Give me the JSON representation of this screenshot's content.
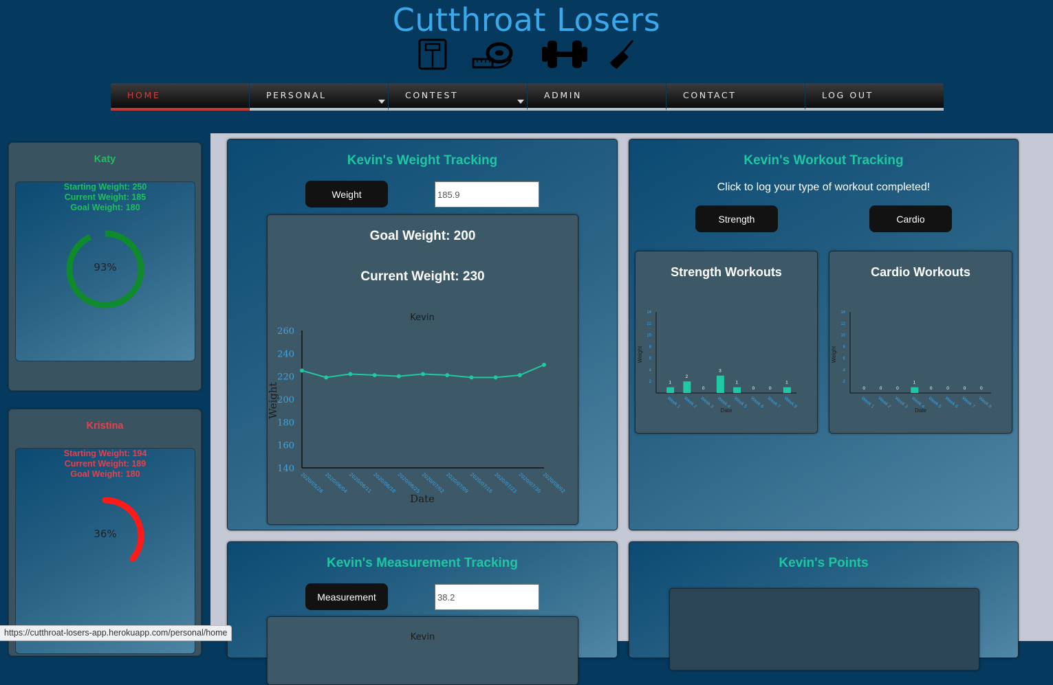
{
  "header": {
    "brand": "Cutthroat Losers",
    "icons": [
      "scale-icon",
      "tape-measure-icon",
      "dumbbell-icon",
      "knife-icon"
    ]
  },
  "nav": {
    "items": [
      {
        "label": "HOME",
        "active": true
      },
      {
        "label": "PERSONAL",
        "dropdown": true
      },
      {
        "label": "CONTEST",
        "dropdown": true
      },
      {
        "label": "ADMIN"
      },
      {
        "label": "CONTACT"
      },
      {
        "label": "LOG OUT"
      }
    ]
  },
  "sidebar": {
    "users": [
      {
        "name": "Katy",
        "starting": "Starting Weight: 250",
        "current": "Current Weight: 185",
        "goal": "Goal Weight: 180",
        "percent_label": "93%",
        "progress": 0.93,
        "color": "#0f8a2c",
        "text_color": "#1fbf5b"
      },
      {
        "name": "Kristina",
        "starting": "Starting Weight: 194",
        "current": "Current Weight: 189",
        "goal": "Goal Weight: 180",
        "percent_label": "36%",
        "progress": 0.36,
        "color": "#ff1a1a",
        "text_color": "#e6414d"
      }
    ]
  },
  "weight_panel": {
    "title": "Kevin's Weight Tracking",
    "button_label": "Weight",
    "input_value": "185.9",
    "goal_text": "Goal Weight: 200",
    "current_text": "Current Weight: 230"
  },
  "workout_panel": {
    "title": "Kevin's Workout Tracking",
    "subtitle": "Click to log your type of workout completed!",
    "strength_label": "Strength",
    "cardio_label": "Cardio",
    "strength_title": "Strength Workouts",
    "cardio_title": "Cardio Workouts"
  },
  "measurement_panel": {
    "title": "Kevin's Measurement Tracking",
    "button_label": "Measurement",
    "input_value": "38.2",
    "chart_title": "Kevin"
  },
  "points_panel": {
    "title": "Kevin's Points"
  },
  "status_url": "https://cutthroat-losers-app.herokuapp.com/personal/home",
  "chart_data": [
    {
      "type": "line",
      "title": "Kevin",
      "xlabel": "Date",
      "ylabel": "Weight",
      "x": [
        "2020/05/28",
        "2020/06/04",
        "2020/06/11",
        "2020/06/18",
        "2020/06/25",
        "2020/07/02",
        "2020/07/09",
        "2020/07/16",
        "2020/07/23",
        "2020/07/30",
        "2020/08/02"
      ],
      "series": [
        {
          "values": [
            225,
            219,
            222,
            221,
            220,
            222,
            221,
            219,
            219,
            221,
            230
          ]
        }
      ],
      "yticks": [
        260,
        240,
        220,
        200,
        180,
        160,
        140
      ],
      "ylim": [
        140,
        260
      ],
      "color": "#1fc9a4"
    },
    {
      "type": "bar",
      "title": "",
      "xlabel": "Date",
      "ylabel": "Weight",
      "categories": [
        "Week 1",
        "Week 2",
        "Week 3",
        "Week 4",
        "Week 5",
        "Week 6",
        "Week 7",
        "Week 8"
      ],
      "values": [
        1,
        2,
        0,
        3,
        1,
        0,
        0,
        1
      ],
      "yticks": [
        14,
        12,
        10,
        8,
        6,
        4,
        2
      ],
      "ylim": [
        0,
        14
      ],
      "color": "#1fc9a4"
    },
    {
      "type": "bar",
      "title": "",
      "xlabel": "Date",
      "ylabel": "Weight",
      "categories": [
        "Week 1",
        "Week 2",
        "Week 3",
        "Week 4",
        "Week 5",
        "Week 6",
        "Week 7",
        "Week 8"
      ],
      "values": [
        0,
        0,
        0,
        1,
        0,
        0,
        0,
        0
      ],
      "yticks": [
        14,
        12,
        10,
        8,
        6,
        4,
        2
      ],
      "ylim": [
        0,
        14
      ],
      "color": "#1fc9a4"
    }
  ]
}
